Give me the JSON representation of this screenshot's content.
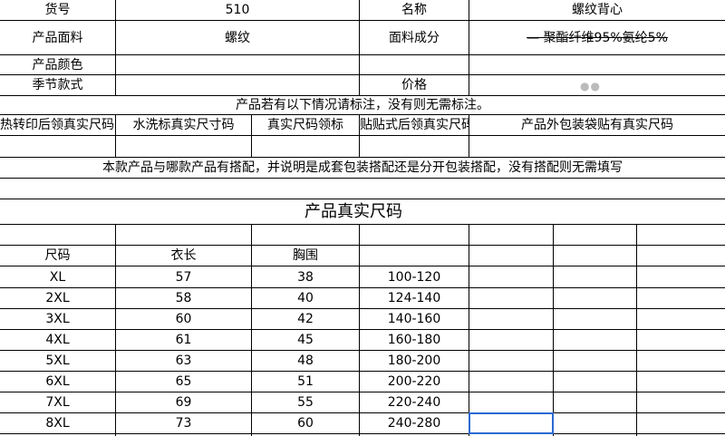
{
  "header": {
    "huohao_label": "货号",
    "huohao_value": "510",
    "name_label": "名称",
    "name_value": "螺纹背心",
    "fabric_label": "产品面料",
    "fabric_value": "螺纹",
    "composition_label": "面料成分",
    "composition_value": "—   聚酯纤维95%氨纶5%",
    "color_label": "产品颜色",
    "season_label": "季节款式",
    "price_label": "价格"
  },
  "notes": {
    "mark_note": "产品若有以下情况请标注，没有则无需标注。",
    "match_note": "本款产品与哪款产品有搭配，并说明是成套包装搭配还是分开包装搭配，没有搭配则无需填写"
  },
  "tag_columns": [
    "热转印后领真实尺码",
    "水洗标真实尺寸码",
    "真实尺码领标",
    "贴贴式后领真实尺码",
    "产品外包装袋贴有真实尺码"
  ],
  "size_table": {
    "title": "产品真实尺码",
    "headers": [
      "尺码",
      "衣长",
      "胸围"
    ],
    "rows": [
      {
        "size": "XL",
        "length": "57",
        "chest": "38",
        "weight": "100-120"
      },
      {
        "size": "2XL",
        "length": "58",
        "chest": "40",
        "weight": "124-140"
      },
      {
        "size": "3XL",
        "length": "60",
        "chest": "42",
        "weight": "140-160"
      },
      {
        "size": "4XL",
        "length": "61",
        "chest": "45",
        "weight": "160-180"
      },
      {
        "size": "5XL",
        "length": "63",
        "chest": "48",
        "weight": "180-200"
      },
      {
        "size": "6XL",
        "length": "65",
        "chest": "51",
        "weight": "200-220"
      },
      {
        "size": "7XL",
        "length": "69",
        "chest": "55",
        "weight": "220-240"
      },
      {
        "size": "8XL",
        "length": "73",
        "chest": "60",
        "weight": "240-280"
      }
    ]
  },
  "colors": {
    "grid": "#000000",
    "selection": "#2a6ad1"
  }
}
